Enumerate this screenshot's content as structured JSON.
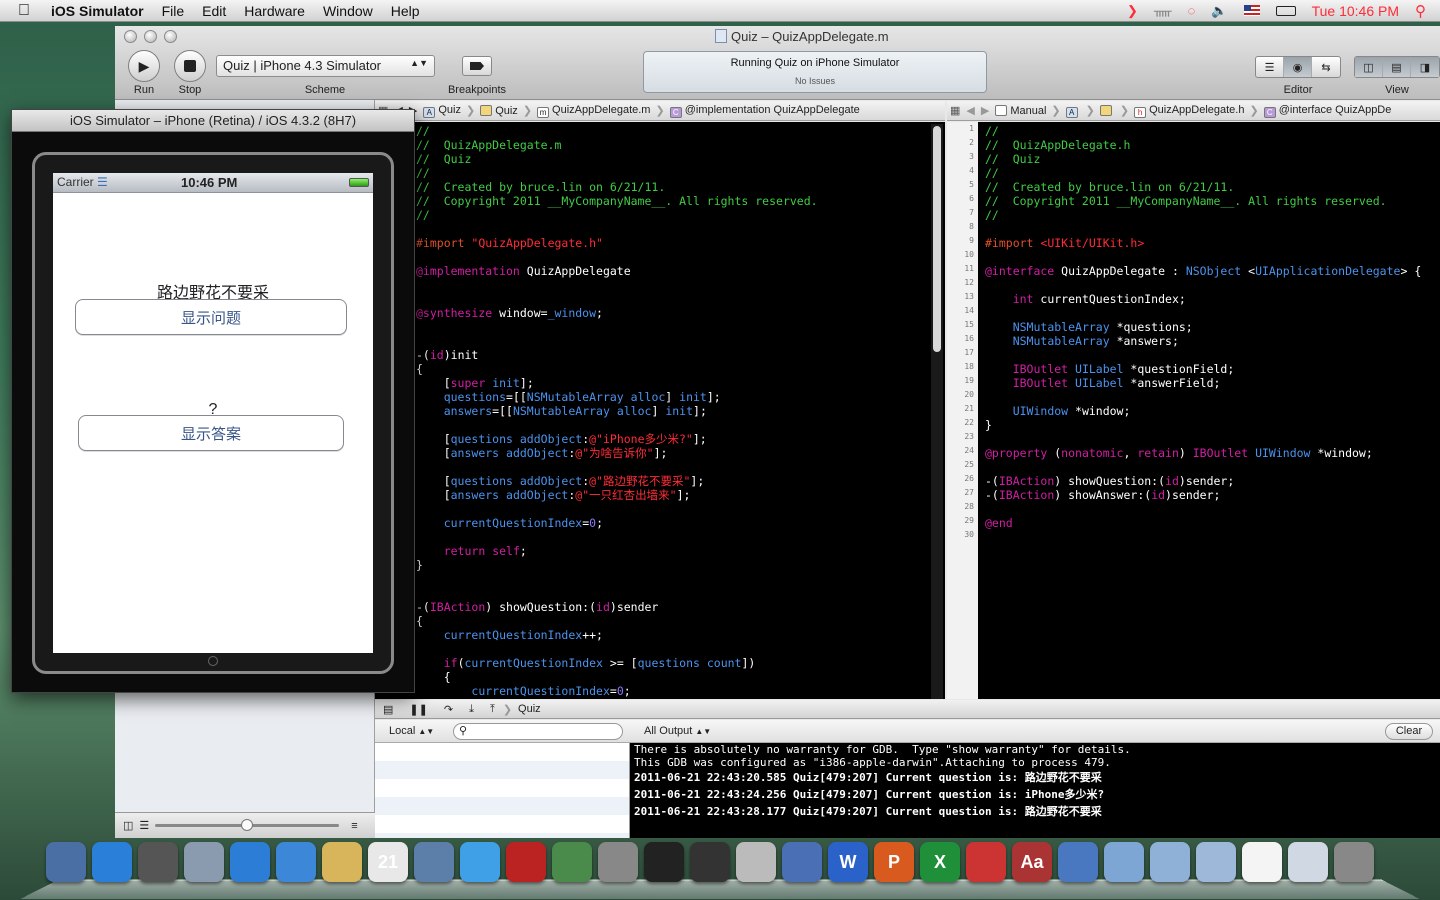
{
  "menubar": {
    "app_name": "iOS Simulator",
    "items": [
      "File",
      "Edit",
      "Hardware",
      "Window",
      "Help"
    ],
    "clock": "Tue 10:46 PM"
  },
  "xcode": {
    "window_title": "Quiz – QuizAppDelegate.m",
    "toolbar": {
      "run_label": "Run",
      "stop_label": "Stop",
      "scheme_label": "Scheme",
      "scheme_value": "Quiz | iPhone 4.3 Simulator",
      "breakpoints_label": "Breakpoints",
      "editor_label": "Editor",
      "view_label": "View"
    },
    "activity": {
      "status": "Running Quiz on iPhone Simulator",
      "issues": "No Issues"
    },
    "left_jumpbar": [
      "Quiz",
      "Quiz",
      "QuizAppDelegate.m",
      "@implementation QuizAppDelegate"
    ],
    "right_jumpbar": [
      "Manual",
      "QuizAppDelegate.h",
      "@interface QuizAppDe"
    ],
    "debug": {
      "target": "Quiz",
      "scope": "Local",
      "search_placeholder": "",
      "output_filter": "All Output",
      "clear_label": "Clear",
      "console_lines": [
        "There is absolutely no warranty for GDB.  Type \"show warranty\" for details.",
        "This GDB was configured as \"i386-apple-darwin\".Attaching to process 479.",
        "2011-06-21 22:43:20.585 Quiz[479:207] Current question is: 路边野花不要采",
        "2011-06-21 22:43:24.256 Quiz[479:207] Current question is: iPhone多少米?",
        "2011-06-21 22:43:28.177 Quiz[479:207] Current question is: 路边野花不要采"
      ]
    }
  },
  "simulator": {
    "title": "iOS Simulator – iPhone (Retina) / iOS 4.3.2 (8H7)",
    "carrier": "Carrier",
    "time": "10:46 PM",
    "question_label": "路边野花不要采",
    "show_question_button": "显示问题",
    "answer_label": "?",
    "show_answer_button": "显示答案"
  },
  "dock_icons": [
    "finder-icon",
    "app-store-icon",
    "dashboard-icon",
    "mail-icon",
    "safari-icon",
    "ichat-icon",
    "address-book-icon",
    "ical-icon",
    "iphoto-icon",
    "itunes-icon",
    "front-row-icon",
    "time-machine-icon",
    "system-preferences-icon",
    "aperture-icon",
    "dvd-icon",
    "preview-icon",
    "xcode-icon",
    "word-icon",
    "powerpoint-icon",
    "excel-icon",
    "parallels-icon",
    "dictionary-icon",
    "instruments-icon",
    "folder-icon",
    "applications-folder-icon",
    "documents-folder-icon",
    "file-icon",
    "downloads-icon",
    "trash-icon"
  ],
  "colors": {
    "comment": "#41cc45",
    "keyword": "#d21fa4",
    "type": "#4b93ee",
    "string": "#ff2c38",
    "preprocessor": "#e0502d",
    "number": "#8a7cfa",
    "ios_button_text": "#385487"
  }
}
